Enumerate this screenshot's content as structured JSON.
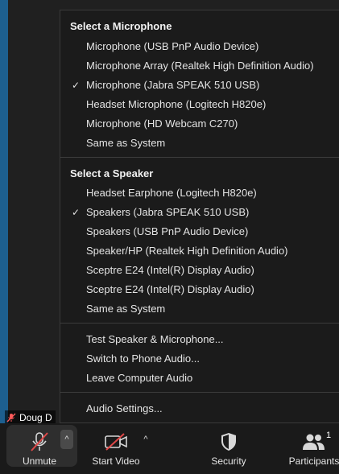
{
  "audio_menu": {
    "microphone_section_title": "Select a Microphone",
    "microphones": [
      {
        "label": "Microphone (USB PnP Audio Device)",
        "checked": false
      },
      {
        "label": "Microphone Array (Realtek High Definition Audio)",
        "checked": false
      },
      {
        "label": "Microphone (Jabra SPEAK 510 USB)",
        "checked": true
      },
      {
        "label": "Headset Microphone (Logitech H820e)",
        "checked": false
      },
      {
        "label": "Microphone (HD Webcam C270)",
        "checked": false
      },
      {
        "label": "Same as System",
        "checked": false
      }
    ],
    "speaker_section_title": "Select a Speaker",
    "speakers": [
      {
        "label": "Headset Earphone (Logitech H820e)",
        "checked": false
      },
      {
        "label": "Speakers (Jabra SPEAK 510 USB)",
        "checked": true
      },
      {
        "label": "Speakers (USB PnP Audio Device)",
        "checked": false
      },
      {
        "label": "Speaker/HP (Realtek High Definition Audio)",
        "checked": false
      },
      {
        "label": "Sceptre E24 (Intel(R) Display Audio)",
        "checked": false
      },
      {
        "label": "Sceptre E24 (Intel(R) Display Audio)",
        "checked": false
      },
      {
        "label": "Same as System",
        "checked": false
      }
    ],
    "actions": [
      {
        "label": "Test Speaker & Microphone..."
      },
      {
        "label": "Switch to Phone Audio..."
      },
      {
        "label": "Leave Computer Audio"
      }
    ],
    "settings_label": "Audio Settings...",
    "check_glyph": "✓"
  },
  "participant_tag": {
    "name": "Doug D"
  },
  "toolbar": {
    "unmute_label": "Unmute",
    "start_video_label": "Start Video",
    "security_label": "Security",
    "participants_label": "Participants",
    "participants_count": "1",
    "caret_glyph": "^"
  }
}
